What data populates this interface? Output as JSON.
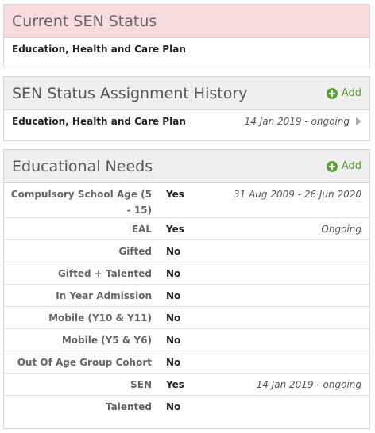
{
  "current_status": {
    "title": "Current SEN Status",
    "value": "Education, Health and Care Plan"
  },
  "history": {
    "title": "SEN Status Assignment History",
    "add_label": "Add",
    "rows": [
      {
        "label": "Education, Health and Care Plan",
        "dates": "14 Jan 2019 - ongoing"
      }
    ]
  },
  "needs": {
    "title": "Educational Needs",
    "add_label": "Add",
    "rows": [
      {
        "name": "Compulsory School Age (5 - 15)",
        "value": "Yes",
        "dates": "31 Aug 2009 - 26 Jun 2020"
      },
      {
        "name": "EAL",
        "value": "Yes",
        "dates": "Ongoing"
      },
      {
        "name": "Gifted",
        "value": "No",
        "dates": ""
      },
      {
        "name": "Gifted + Talented",
        "value": "No",
        "dates": ""
      },
      {
        "name": "In Year Admission",
        "value": "No",
        "dates": ""
      },
      {
        "name": "Mobile (Y10 & Y11)",
        "value": "No",
        "dates": ""
      },
      {
        "name": "Mobile (Y5 & Y6)",
        "value": "No",
        "dates": ""
      },
      {
        "name": "Out Of Age Group Cohort",
        "value": "No",
        "dates": ""
      },
      {
        "name": "SEN",
        "value": "Yes",
        "dates": "14 Jan 2019 - ongoing"
      },
      {
        "name": "Talented",
        "value": "No",
        "dates": ""
      }
    ]
  },
  "colors": {
    "status_header_bg": "#f7dcdd",
    "section_header_bg": "#efefef",
    "add_green": "#5aa335"
  },
  "icons": {
    "add": "plus-circle-icon",
    "expand": "triangle-right-icon"
  }
}
